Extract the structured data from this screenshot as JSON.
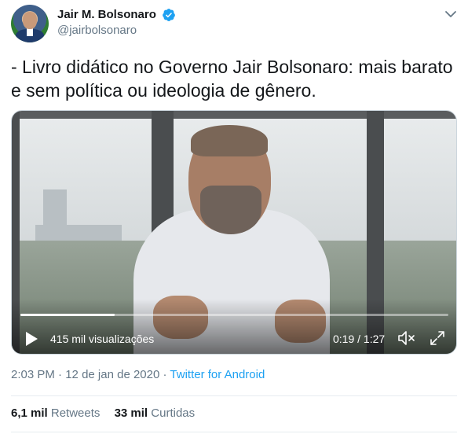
{
  "author": {
    "display_name": "Jair M. Bolsonaro",
    "handle": "@jairbolsonaro",
    "verified": true
  },
  "tweet": {
    "text": "- Livro didático no Governo Jair Bolsonaro: mais barato e sem política ou ideologia de gênero."
  },
  "video": {
    "views_label": "415 mil visualizações",
    "time_label": "0:19 / 1:27",
    "progress_fraction": 0.22
  },
  "meta": {
    "time": "2:03 PM",
    "separator1": " · ",
    "date": "12 de jan de 2020",
    "separator2": " · ",
    "source": "Twitter for Android"
  },
  "stats": {
    "retweets_count": "6,1 mil",
    "retweets_label": "Retweets",
    "likes_count": "33 mil",
    "likes_label": "Curtidas"
  },
  "colors": {
    "accent": "#1da1f2",
    "secondary_text": "#657786"
  },
  "icons": {
    "verified": "verified-badge-icon",
    "caret": "chevron-down-icon",
    "play": "play-icon",
    "mute": "volume-muted-icon",
    "fullscreen": "fullscreen-icon"
  }
}
